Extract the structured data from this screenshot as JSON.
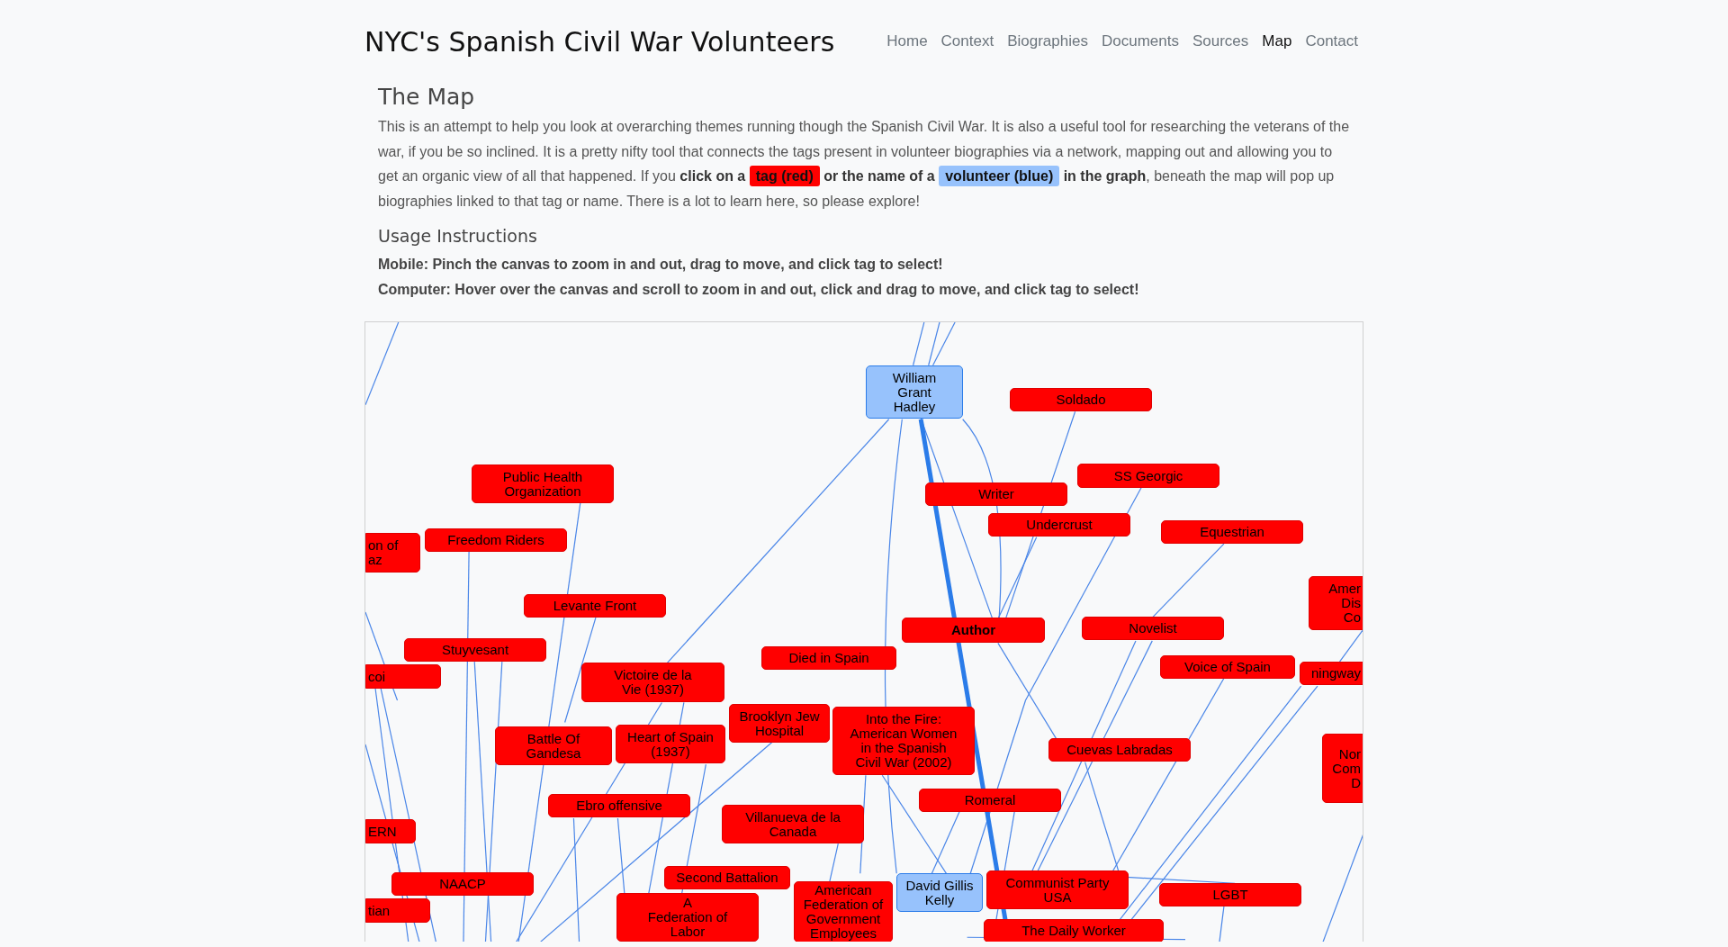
{
  "site_title": "NYC's Spanish Civil War Volunteers",
  "nav": [
    {
      "label": "Home",
      "selected": false
    },
    {
      "label": "Context",
      "selected": false
    },
    {
      "label": "Biographies",
      "selected": false
    },
    {
      "label": "Documents",
      "selected": false
    },
    {
      "label": "Sources",
      "selected": false
    },
    {
      "label": "Map",
      "selected": true
    },
    {
      "label": "Contact",
      "selected": false
    }
  ],
  "heading": "The Map",
  "intro": [
    {
      "kind": "text",
      "text": "This is an attempt to help you look at overarching themes running though the Spanish Civil War. It is also a useful tool for researching the veterans of the war, if you be so inclined. It is a pretty nifty tool that connects the tags present in volunteer biographies via a network, mapping out and allowing you to get an organic view of all that happened. If you **click on a**"
    },
    {
      "kind": "tag",
      "text": "tag (red)"
    },
    {
      "kind": "text",
      "text": "**or the name of a**"
    },
    {
      "kind": "volunteer",
      "text": "volunteer (blue)"
    },
    {
      "kind": "text",
      "text": "**in the graph**, beneath the map will pop up biographies linked to that tag or name. There is a lot to learn here, so please explore!"
    }
  ],
  "usage": {
    "title": "Usage Instructions",
    "lines": [
      "Mobile: Pinch the canvas to zoom in and out, drag to move, and click tag to select!",
      "Computer: Hover over the canvas and scroll to zoom in and out, click and drag to move, and click tag to select!"
    ]
  },
  "graph": {
    "nodes": [
      {
        "label": "William\nGrant\nHadley",
        "kind": "volunteer",
        "highlighted": false
      },
      {
        "label": "Soldado",
        "kind": "tag",
        "highlighted": false
      },
      {
        "label": "Public Health\nOrganization",
        "kind": "tag",
        "highlighted": false
      },
      {
        "label": "Writer",
        "kind": "tag",
        "highlighted": false
      },
      {
        "label": "SS Georgic",
        "kind": "tag",
        "highlighted": false
      },
      {
        "label": "on of\naz",
        "kind": "tag",
        "highlighted": false
      },
      {
        "label": "Freedom Riders",
        "kind": "tag",
        "highlighted": false
      },
      {
        "label": "Undercrust",
        "kind": "tag",
        "highlighted": false
      },
      {
        "label": "Equestrian",
        "kind": "tag",
        "highlighted": false
      },
      {
        "label": "Levante Front",
        "kind": "tag",
        "highlighted": false
      },
      {
        "label": "Stuyvesant",
        "kind": "tag",
        "highlighted": false
      },
      {
        "label": "Author",
        "kind": "tag",
        "highlighted": true
      },
      {
        "label": "Novelist",
        "kind": "tag",
        "highlighted": false
      },
      {
        "label": "Amer\nDis\nCo",
        "kind": "tag",
        "highlighted": false
      },
      {
        "label": "coi",
        "kind": "tag",
        "highlighted": false
      },
      {
        "label": "Victoire de la\nVie (1937)",
        "kind": "tag",
        "highlighted": false
      },
      {
        "label": "Died in Spain",
        "kind": "tag",
        "highlighted": false
      },
      {
        "label": "Voice of Spain",
        "kind": "tag",
        "highlighted": false
      },
      {
        "label": "ningway",
        "kind": "tag",
        "highlighted": false
      },
      {
        "label": "Battle Of\nGandesa",
        "kind": "tag",
        "highlighted": false
      },
      {
        "label": "Heart of Spain\n(1937)",
        "kind": "tag",
        "highlighted": false
      },
      {
        "label": "Brooklyn Jew\nHospital",
        "kind": "tag",
        "highlighted": false
      },
      {
        "label": "Into the Fire:\nAmerican Women\nin the Spanish\nCivil War (2002)",
        "kind": "tag",
        "highlighted": false
      },
      {
        "label": "Cuevas Labradas",
        "kind": "tag",
        "highlighted": false
      },
      {
        "label": "ERN",
        "kind": "tag",
        "highlighted": false
      },
      {
        "label": "Ebro offensive",
        "kind": "tag",
        "highlighted": false
      },
      {
        "label": "Villanueva de la\nCanada",
        "kind": "tag",
        "highlighted": false
      },
      {
        "label": "Romeral",
        "kind": "tag",
        "highlighted": false
      },
      {
        "label": "Nor\nCom\nD",
        "kind": "tag",
        "highlighted": false
      },
      {
        "label": "tian",
        "kind": "tag",
        "highlighted": false
      },
      {
        "label": "NAACP",
        "kind": "tag",
        "highlighted": false
      },
      {
        "label": "Second Battalion",
        "kind": "tag",
        "highlighted": false
      },
      {
        "label": "A\nFederation of\nLabor",
        "kind": "tag",
        "highlighted": false
      },
      {
        "label": "American\nFederation of\nGovernment\nEmployees",
        "kind": "tag",
        "highlighted": false
      },
      {
        "label": "David Gillis\nKelly",
        "kind": "volunteer",
        "highlighted": false
      },
      {
        "label": "Communist Party\nUSA",
        "kind": "tag",
        "highlighted": false
      },
      {
        "label": "LGBT",
        "kind": "tag",
        "highlighted": false
      },
      {
        "label": "The Daily Worker",
        "kind": "tag",
        "highlighted": false
      }
    ]
  }
}
